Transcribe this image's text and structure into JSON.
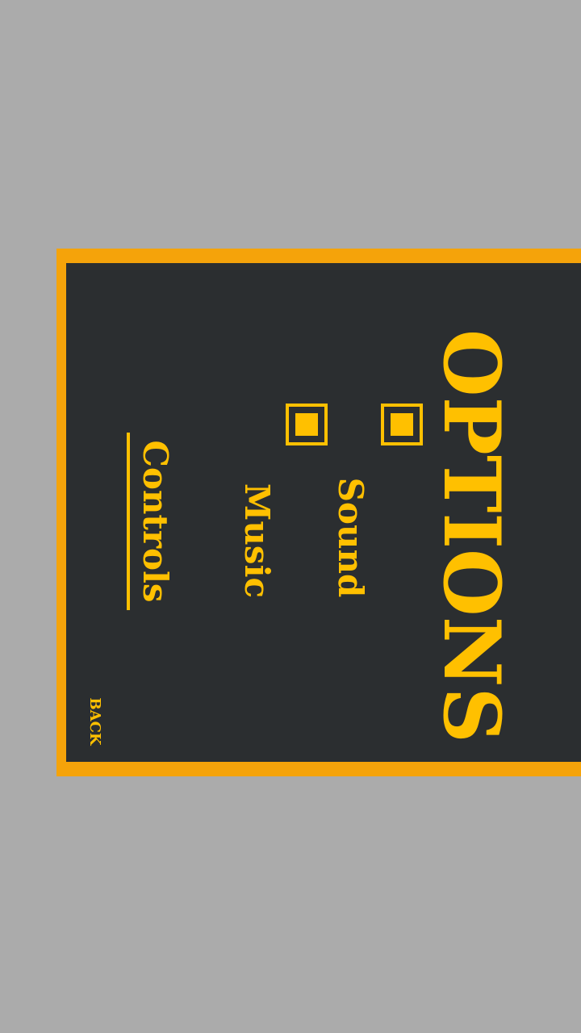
{
  "screen": {
    "title": "OPTIONS",
    "options": [
      {
        "label": "Sound",
        "checked": true
      },
      {
        "label": "Music",
        "checked": true
      }
    ],
    "controls_label": "Controls",
    "back_label": "BACK"
  },
  "colors": {
    "background": "#ababab",
    "panel_border": "#f5a30a",
    "panel_fill": "#2b2e30",
    "accent": "#ffc000"
  }
}
